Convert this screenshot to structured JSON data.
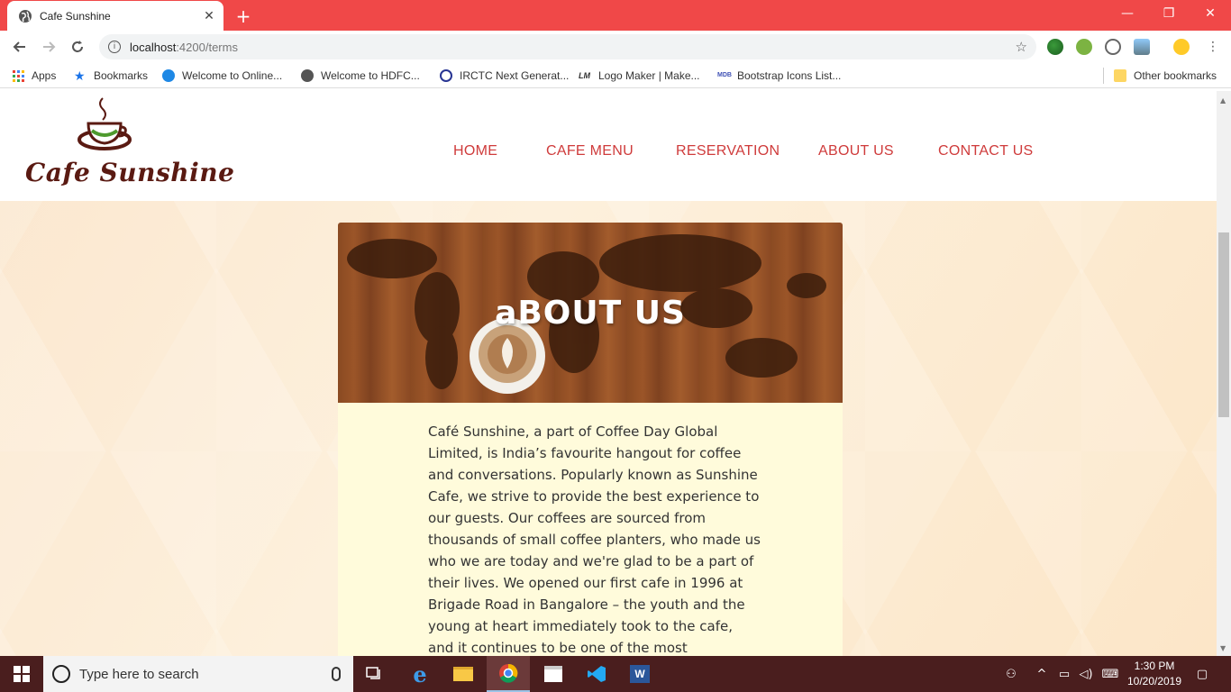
{
  "browser": {
    "tab_title": "Cafe Sunshine",
    "tab_close": "✕",
    "new_tab": "+",
    "url_host": "localhost",
    "url_path": ":4200/terms",
    "window_controls": {
      "minimize": "—",
      "restore": "❐",
      "close": "✕"
    }
  },
  "bookmarks": {
    "apps": "Apps",
    "items": [
      "Bookmarks",
      "Welcome to Online...",
      "Welcome to HDFC...",
      "IRCTC Next Generat...",
      "Logo Maker | Make...",
      "Bootstrap Icons List..."
    ],
    "other": "Other bookmarks"
  },
  "site": {
    "brand": "Cafe Sunshine",
    "nav": [
      "HOME",
      "CAFE MENU",
      "RESERVATION",
      "ABOUT US",
      "CONTACT US"
    ],
    "hero_title": "aBOUT US",
    "about_text": "Café Sunshine, a part of Coffee Day Global Limited, is India’s favourite hangout for coffee and conversations. Popularly known as Sunshine Cafe, we strive to provide the best experience to our guests. Our coffees are sourced from thousands of small coffee planters, who made us who we are today and we're glad to be a part of their lives. We opened our first cafe in 1996 at Brigade Road in Bangalore – the youth and the young at heart immediately took to the cafe, and it continues to be one of the most happening places in the city."
  },
  "taskbar": {
    "search_placeholder": "Type here to search",
    "time": "1:30 PM",
    "date": "10/20/2019"
  },
  "colors": {
    "chrome_titlebar": "#f04848",
    "nav_link": "#cf3b3b",
    "brand_text": "#5a1a12",
    "about_panel": "#fffbdb",
    "taskbar": "#4a1e1e"
  }
}
